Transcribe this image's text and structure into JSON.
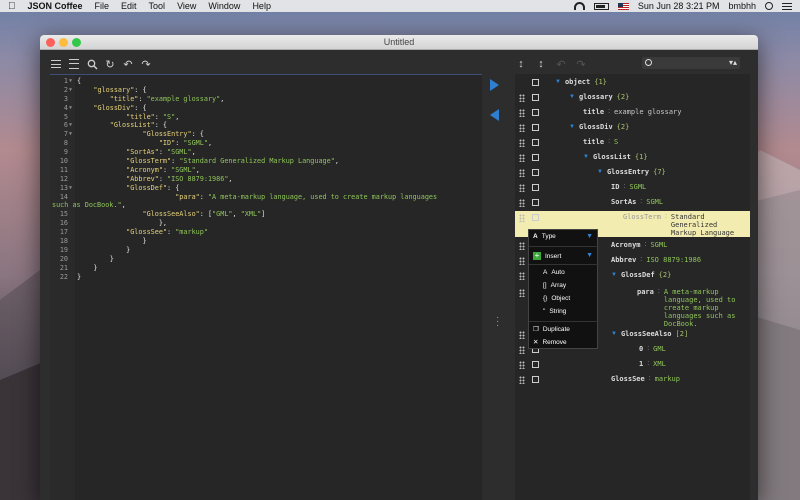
{
  "menubar": {
    "app_name": "JSON Coffee",
    "items": [
      "File",
      "Edit",
      "Tool",
      "View",
      "Window",
      "Help"
    ],
    "date_time": "Sun Jun 28  3:21 PM",
    "user": "bmbhh"
  },
  "window": {
    "title": "Untitled"
  },
  "editor": {
    "lines": [
      {
        "n": "1",
        "fold": true,
        "parts": [
          {
            "t": "{",
            "c": ""
          }
        ]
      },
      {
        "n": "2",
        "fold": true,
        "parts": [
          {
            "t": "    \"glossary\"",
            "c": "k"
          },
          {
            "t": ": {",
            "c": ""
          }
        ]
      },
      {
        "n": "3",
        "fold": false,
        "parts": [
          {
            "t": "        \"title\"",
            "c": "k"
          },
          {
            "t": ": ",
            "c": ""
          },
          {
            "t": "\"example glossary\"",
            "c": "s"
          },
          {
            "t": ",",
            "c": ""
          }
        ]
      },
      {
        "n": "4",
        "fold": true,
        "parts": [
          {
            "t": "    \"GlossDiv\"",
            "c": "k"
          },
          {
            "t": ": {",
            "c": ""
          }
        ]
      },
      {
        "n": "5",
        "fold": false,
        "parts": [
          {
            "t": "            \"title\"",
            "c": "k"
          },
          {
            "t": ": ",
            "c": ""
          },
          {
            "t": "\"S\"",
            "c": "s"
          },
          {
            "t": ",",
            "c": ""
          }
        ]
      },
      {
        "n": "6",
        "fold": true,
        "parts": [
          {
            "t": "        \"GlossList\"",
            "c": "k"
          },
          {
            "t": ": {",
            "c": ""
          }
        ]
      },
      {
        "n": "7",
        "fold": true,
        "parts": [
          {
            "t": "                \"GlossEntry\"",
            "c": "k"
          },
          {
            "t": ": {",
            "c": ""
          }
        ]
      },
      {
        "n": "8",
        "fold": false,
        "parts": [
          {
            "t": "                    \"ID\"",
            "c": "k"
          },
          {
            "t": ": ",
            "c": ""
          },
          {
            "t": "\"SGML\"",
            "c": "s"
          },
          {
            "t": ",",
            "c": ""
          }
        ]
      },
      {
        "n": "9",
        "fold": false,
        "parts": [
          {
            "t": "            \"SortAs\"",
            "c": "k"
          },
          {
            "t": ": ",
            "c": ""
          },
          {
            "t": "\"SGML\"",
            "c": "s"
          },
          {
            "t": ",",
            "c": ""
          }
        ]
      },
      {
        "n": "10",
        "fold": false,
        "parts": [
          {
            "t": "            \"GlossTerm\"",
            "c": "k"
          },
          {
            "t": ": ",
            "c": ""
          },
          {
            "t": "\"Standard Generalized Markup Language\"",
            "c": "s"
          },
          {
            "t": ",",
            "c": ""
          }
        ]
      },
      {
        "n": "11",
        "fold": false,
        "parts": [
          {
            "t": "            \"Acronym\"",
            "c": "k"
          },
          {
            "t": ": ",
            "c": ""
          },
          {
            "t": "\"SGML\"",
            "c": "s"
          },
          {
            "t": ",",
            "c": ""
          }
        ]
      },
      {
        "n": "12",
        "fold": false,
        "parts": [
          {
            "t": "            \"Abbrev\"",
            "c": "k"
          },
          {
            "t": ": ",
            "c": ""
          },
          {
            "t": "\"ISO 8879:1986\"",
            "c": "s"
          },
          {
            "t": ",",
            "c": ""
          }
        ]
      },
      {
        "n": "13",
        "fold": true,
        "parts": [
          {
            "t": "            \"GlossDef\"",
            "c": "k"
          },
          {
            "t": ": {",
            "c": ""
          }
        ]
      },
      {
        "n": "14",
        "fold": false,
        "parts": [
          {
            "t": "                        \"para\"",
            "c": "k"
          },
          {
            "t": ": ",
            "c": ""
          },
          {
            "t": "\"A meta-markup language, used to create markup languages",
            "c": "s"
          }
        ]
      },
      {
        "n": "",
        "fold": false,
        "wrap": true,
        "parts": [
          {
            "t": "such as DocBook.\"",
            "c": "s"
          },
          {
            "t": ",",
            "c": ""
          }
        ]
      },
      {
        "n": "15",
        "fold": false,
        "parts": [
          {
            "t": "                \"GlossSeeAlso\"",
            "c": "k"
          },
          {
            "t": ": [",
            "c": ""
          },
          {
            "t": "\"GML\"",
            "c": "s"
          },
          {
            "t": ", ",
            "c": ""
          },
          {
            "t": "\"XML\"",
            "c": "s"
          },
          {
            "t": "]",
            "c": ""
          }
        ]
      },
      {
        "n": "16",
        "fold": false,
        "parts": [
          {
            "t": "                    },",
            "c": ""
          }
        ]
      },
      {
        "n": "17",
        "fold": false,
        "parts": [
          {
            "t": "            \"GlossSee\"",
            "c": "k"
          },
          {
            "t": ": ",
            "c": ""
          },
          {
            "t": "\"markup\"",
            "c": "s"
          }
        ]
      },
      {
        "n": "18",
        "fold": false,
        "parts": [
          {
            "t": "                }",
            "c": ""
          }
        ]
      },
      {
        "n": "19",
        "fold": false,
        "parts": [
          {
            "t": "            }",
            "c": ""
          }
        ]
      },
      {
        "n": "20",
        "fold": false,
        "parts": [
          {
            "t": "        }",
            "c": ""
          }
        ]
      },
      {
        "n": "21",
        "fold": false,
        "parts": [
          {
            "t": "    }",
            "c": ""
          }
        ]
      },
      {
        "n": "22",
        "fold": false,
        "parts": [
          {
            "t": "}",
            "c": ""
          }
        ]
      }
    ]
  },
  "tree": {
    "rows": [
      {
        "key": "object",
        "count": "{1}",
        "arrow": true
      },
      {
        "key": "glossary",
        "count": "{2}",
        "arrow": true
      },
      {
        "key": "title",
        "value": "example glossary"
      },
      {
        "key": "GlossDiv",
        "count": "{2}",
        "arrow": true
      },
      {
        "key": "title",
        "value": "S"
      },
      {
        "key": "GlossList",
        "count": "{1}",
        "arrow": true
      },
      {
        "key": "GlossEntry",
        "count": "{7}",
        "arrow": true
      },
      {
        "key": "ID",
        "value": "SGML"
      },
      {
        "key": "SortAs",
        "value": "SGML"
      },
      {
        "key": "GlossTerm",
        "value": "Standard Generalized Markup Language",
        "highlight": true
      },
      {
        "key": "Acronym",
        "value": "SGML"
      },
      {
        "key": "Abbrev",
        "value": "ISO 8879:1986"
      },
      {
        "key": "GlossDef",
        "count": "{2}",
        "arrow": true
      },
      {
        "key": "para",
        "value": "A meta-markup language, used to create markup languages such as DocBook."
      },
      {
        "key": "GlossSeeAlso",
        "count": "[2]",
        "arrow": true
      },
      {
        "key": "0",
        "value": "GML"
      },
      {
        "key": "1",
        "value": "XML"
      },
      {
        "key": "GlossSee",
        "value": "markup"
      }
    ]
  },
  "context_menu": {
    "type_label": "Type",
    "insert_label": "Insert",
    "insert_items": [
      "Auto",
      "Array",
      "Object",
      "String"
    ],
    "duplicate_label": "Duplicate",
    "remove_label": "Remove"
  }
}
